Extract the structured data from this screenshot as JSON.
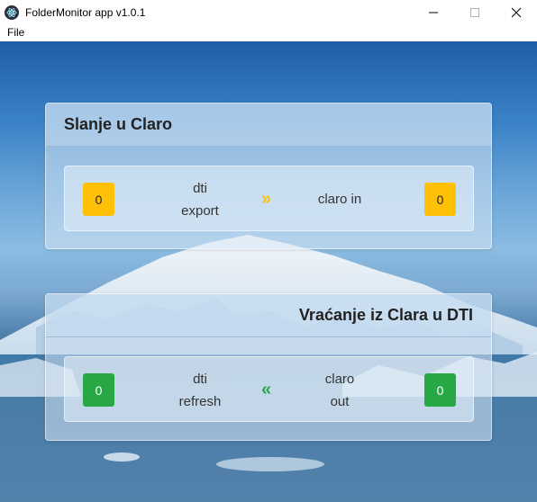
{
  "window": {
    "title": "FolderMonitor app v1.0.1"
  },
  "menu": {
    "items": [
      "File"
    ]
  },
  "send_card": {
    "title": "Slanje u Claro",
    "source_count": "0",
    "source_label_line1": "dti",
    "source_label_line2": "export",
    "arrow": "»",
    "dest_label": "claro in",
    "dest_count": "0",
    "color": "#ffc107"
  },
  "return_card": {
    "title": "Vraćanje iz Clara u DTI",
    "source_count": "0",
    "source_label_line1": "dti",
    "source_label_line2": "refresh",
    "arrow": "«",
    "dest_label_line1": "claro",
    "dest_label_line2": "out",
    "dest_count": "0",
    "color": "#28a745"
  }
}
